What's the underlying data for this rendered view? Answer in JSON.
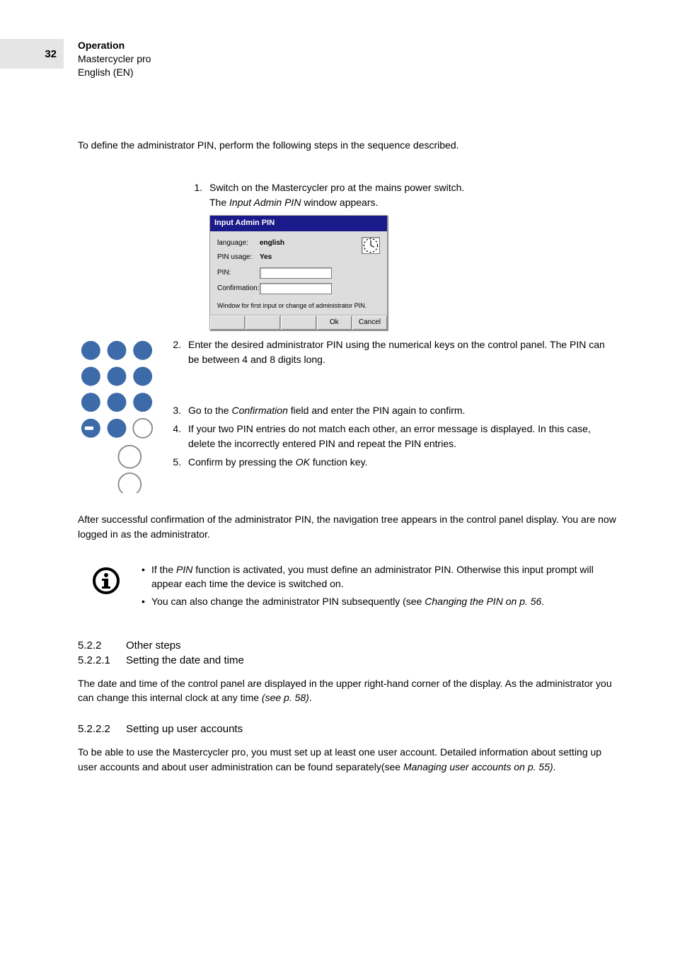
{
  "page_number": "32",
  "header": {
    "chapter": "Operation",
    "product": "Mastercycler pro",
    "language": "English (EN)"
  },
  "intro": "To define the administrator PIN, perform the following steps in the sequence described.",
  "steps": {
    "s1a": "Switch on the Mastercycler pro at the mains power switch.",
    "s1b_pre": "The ",
    "s1b_i": "Input Admin PIN",
    "s1b_post": " window appears.",
    "s2": "Enter the desired administrator PIN using the numerical keys on the control panel. The PIN can be between 4 and 8 digits long.",
    "s3_pre": "Go to the ",
    "s3_i": "Confirmation",
    "s3_post": " field and enter the PIN again to confirm.",
    "s4": "If your two PIN entries do not match each other, an error message is displayed. In this case, delete the incorrectly entered PIN and repeat the PIN entries.",
    "s5_pre": "Confirm by pressing the ",
    "s5_i": "OK",
    "s5_post": " function key."
  },
  "dialog": {
    "title": "Input Admin PIN",
    "row_lang_label": "language:",
    "row_lang_value": "english",
    "row_usage_label": "PIN usage:",
    "row_usage_value": "Yes",
    "row_pin_label": "PIN:",
    "row_conf_label": "Confirmation:",
    "msg": "Window for first input or change of administrator PIN.",
    "btn_ok": "Ok",
    "btn_cancel": "Cancel"
  },
  "after1": "After successful confirmation of the administrator PIN, the navigation tree appears in the control panel display. You are now logged in as the administrator.",
  "info": {
    "li1_pre": "If the ",
    "li1_i": "PIN",
    "li1_post": " function is activated, you must define an administrator PIN. Otherwise this input prompt will appear each time the device is switched on.",
    "li2_pre": "You can also change the administrator PIN subsequently (see ",
    "li2_i": "Changing the PIN on p. 56",
    "li2_post": "."
  },
  "sect522_num": "5.2.2",
  "sect522_title": "Other steps",
  "sect5221_num": "5.2.2.1",
  "sect5221_title": "Setting the date and time",
  "sect5221_body_pre": "The date and time of the control panel are displayed in the upper right-hand corner of the display. As the administrator you can change this internal clock at any time ",
  "sect5221_body_i": "(see p. 58)",
  "sect5221_body_post": ".",
  "sect5222_num": "5.2.2.2",
  "sect5222_title": "Setting up user accounts",
  "sect5222_body_pre": "To be able to use the Mastercycler pro, you must set up at least one user account. Detailed information about setting up user accounts and about user administration can be found separately(see ",
  "sect5222_body_i": "Managing user accounts on p. 55)",
  "sect5222_body_post": "."
}
